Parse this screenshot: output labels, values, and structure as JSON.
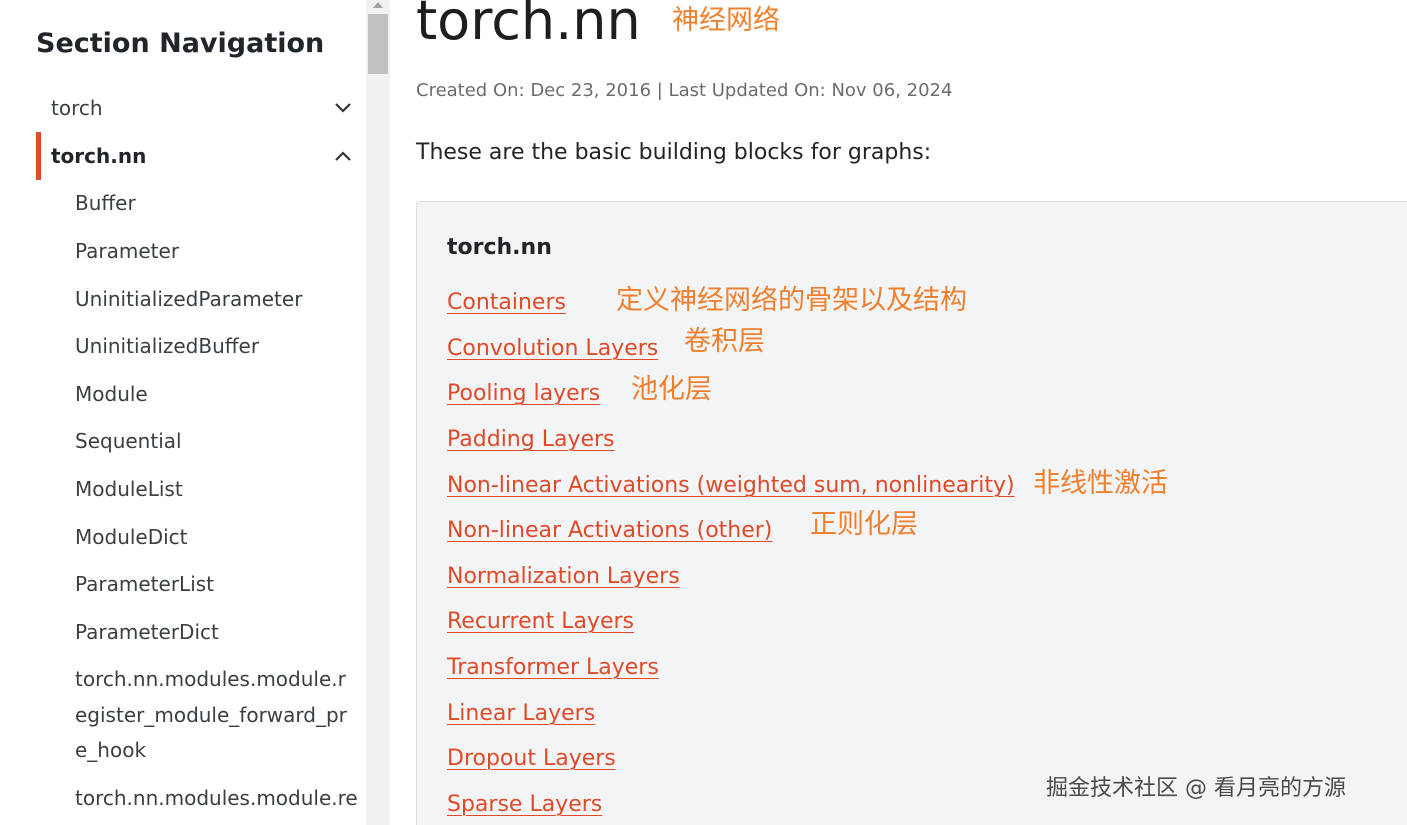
{
  "sidebar": {
    "title": "Section Navigation",
    "items": [
      {
        "label": "torch"
      },
      {
        "label": "torch.nn"
      }
    ],
    "sub_items": [
      "Buffer",
      "Parameter",
      "UninitializedParameter",
      "UninitializedBuffer",
      "Module",
      "Sequential",
      "ModuleList",
      "ModuleDict",
      "ParameterList",
      "ParameterDict",
      "torch.nn.modules.module.register_module_forward_pre_hook",
      "torch.nn.modules.module.re"
    ]
  },
  "main": {
    "title": "torch.nn",
    "title_annotation": "神经网络",
    "meta": "Created On: Dec 23, 2016 | Last Updated On: Nov 06, 2024",
    "intro": "These are the basic building blocks for graphs:",
    "card": {
      "title": "torch.nn",
      "links": [
        "Containers",
        "Convolution Layers",
        "Pooling layers",
        "Padding Layers",
        "Non-linear Activations (weighted sum, nonlinearity)",
        "Non-linear Activations (other)",
        "Normalization Layers",
        "Recurrent Layers",
        "Transformer Layers",
        "Linear Layers",
        "Dropout Layers",
        "Sparse Layers"
      ],
      "annotations": [
        "定义神经网络的骨架以及结构",
        "卷积层",
        "池化层",
        "非线性激活",
        "正则化层"
      ]
    }
  },
  "watermark": "掘金技术社区 @ 看月亮的方源",
  "colors": {
    "accent": "#e04a29",
    "annotation": "#f07f2e",
    "card_bg": "#f3f4f5"
  }
}
